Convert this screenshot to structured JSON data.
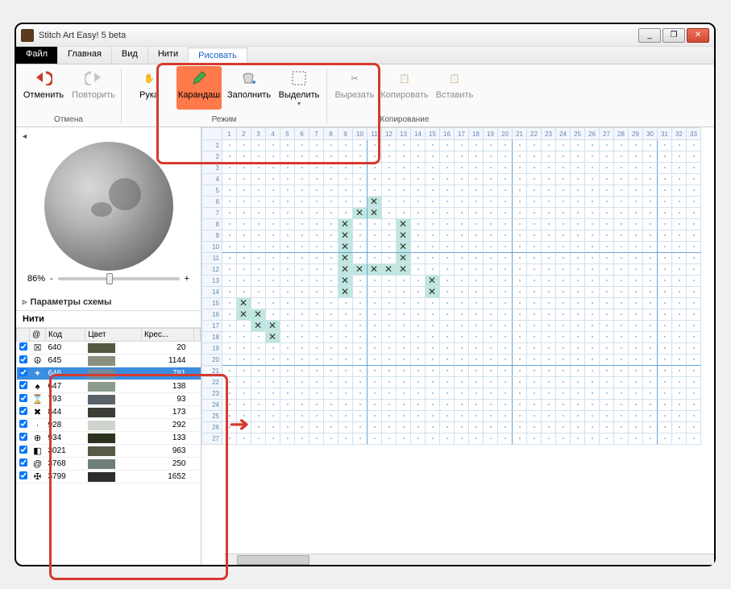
{
  "title": "Stitch Art Easy! 5 beta",
  "window_buttons": {
    "min": "_",
    "max": "❐",
    "close": "✕"
  },
  "ribbon": {
    "tabs": {
      "file": "Файл",
      "home": "Главная",
      "view": "Вид",
      "threads": "Нити",
      "draw": "Рисовать"
    },
    "active_tab": "draw",
    "groups": {
      "undo_redo": {
        "label": "Отмена",
        "undo": "Отменить",
        "redo": "Повторить"
      },
      "mode": {
        "label": "Режим",
        "hand": "Рука",
        "pencil": "Карандаш",
        "fill": "Заполнить",
        "select": "Выделить"
      },
      "copy": {
        "label": "Копирование",
        "cut": "Вырезать",
        "copy": "Копировать",
        "paste": "Вставить"
      }
    },
    "selected_tool": "pencil"
  },
  "sidebar": {
    "zoom_percent": "86%",
    "zoom_minus": "-",
    "zoom_plus": "+",
    "params_label": "Параметры схемы",
    "threads_label": "Нити",
    "columns": {
      "at": "@",
      "code": "Код",
      "color": "Цвет",
      "crosses": "Крес..."
    },
    "rows": [
      {
        "sym": "☒",
        "code": "640",
        "color": "#565840",
        "count": "20"
      },
      {
        "sym": "☮",
        "code": "645",
        "color": "#8a8f7f",
        "count": "1144"
      },
      {
        "sym": "✦",
        "code": "646",
        "color": "#6f8b9c",
        "count": "781",
        "sel": true
      },
      {
        "sym": "♠",
        "code": "647",
        "color": "#8c9c8c",
        "count": "138"
      },
      {
        "sym": "⌛",
        "code": "793",
        "color": "#5a626a",
        "count": "93"
      },
      {
        "sym": "✖",
        "code": "844",
        "color": "#3a3e36",
        "count": "173"
      },
      {
        "sym": "·",
        "code": "928",
        "color": "#cfd5cd",
        "count": "292"
      },
      {
        "sym": "⊕",
        "code": "934",
        "color": "#2c3420",
        "count": "133"
      },
      {
        "sym": "◧",
        "code": "3021",
        "color": "#565a46",
        "count": "963"
      },
      {
        "sym": "@",
        "code": "3768",
        "color": "#6e7e7a",
        "count": "250"
      },
      {
        "sym": "✠",
        "code": "3799",
        "color": "#2c2e2c",
        "count": "1652"
      }
    ]
  },
  "grid": {
    "cols": 33,
    "rows": 27,
    "stitches": [
      {
        "r": 6,
        "c": 11
      },
      {
        "r": 7,
        "c": 10
      },
      {
        "r": 7,
        "c": 11
      },
      {
        "r": 8,
        "c": 9
      },
      {
        "r": 8,
        "c": 13
      },
      {
        "r": 9,
        "c": 9
      },
      {
        "r": 9,
        "c": 13
      },
      {
        "r": 10,
        "c": 9
      },
      {
        "r": 10,
        "c": 13
      },
      {
        "r": 11,
        "c": 9
      },
      {
        "r": 11,
        "c": 13
      },
      {
        "r": 12,
        "c": 9
      },
      {
        "r": 12,
        "c": 10
      },
      {
        "r": 12,
        "c": 11
      },
      {
        "r": 12,
        "c": 12
      },
      {
        "r": 12,
        "c": 13
      },
      {
        "r": 13,
        "c": 9
      },
      {
        "r": 13,
        "c": 15
      },
      {
        "r": 14,
        "c": 9
      },
      {
        "r": 14,
        "c": 15
      },
      {
        "r": 15,
        "c": 2
      },
      {
        "r": 16,
        "c": 2
      },
      {
        "r": 16,
        "c": 3
      },
      {
        "r": 17,
        "c": 3
      },
      {
        "r": 17,
        "c": 4
      },
      {
        "r": 18,
        "c": 4
      }
    ]
  }
}
